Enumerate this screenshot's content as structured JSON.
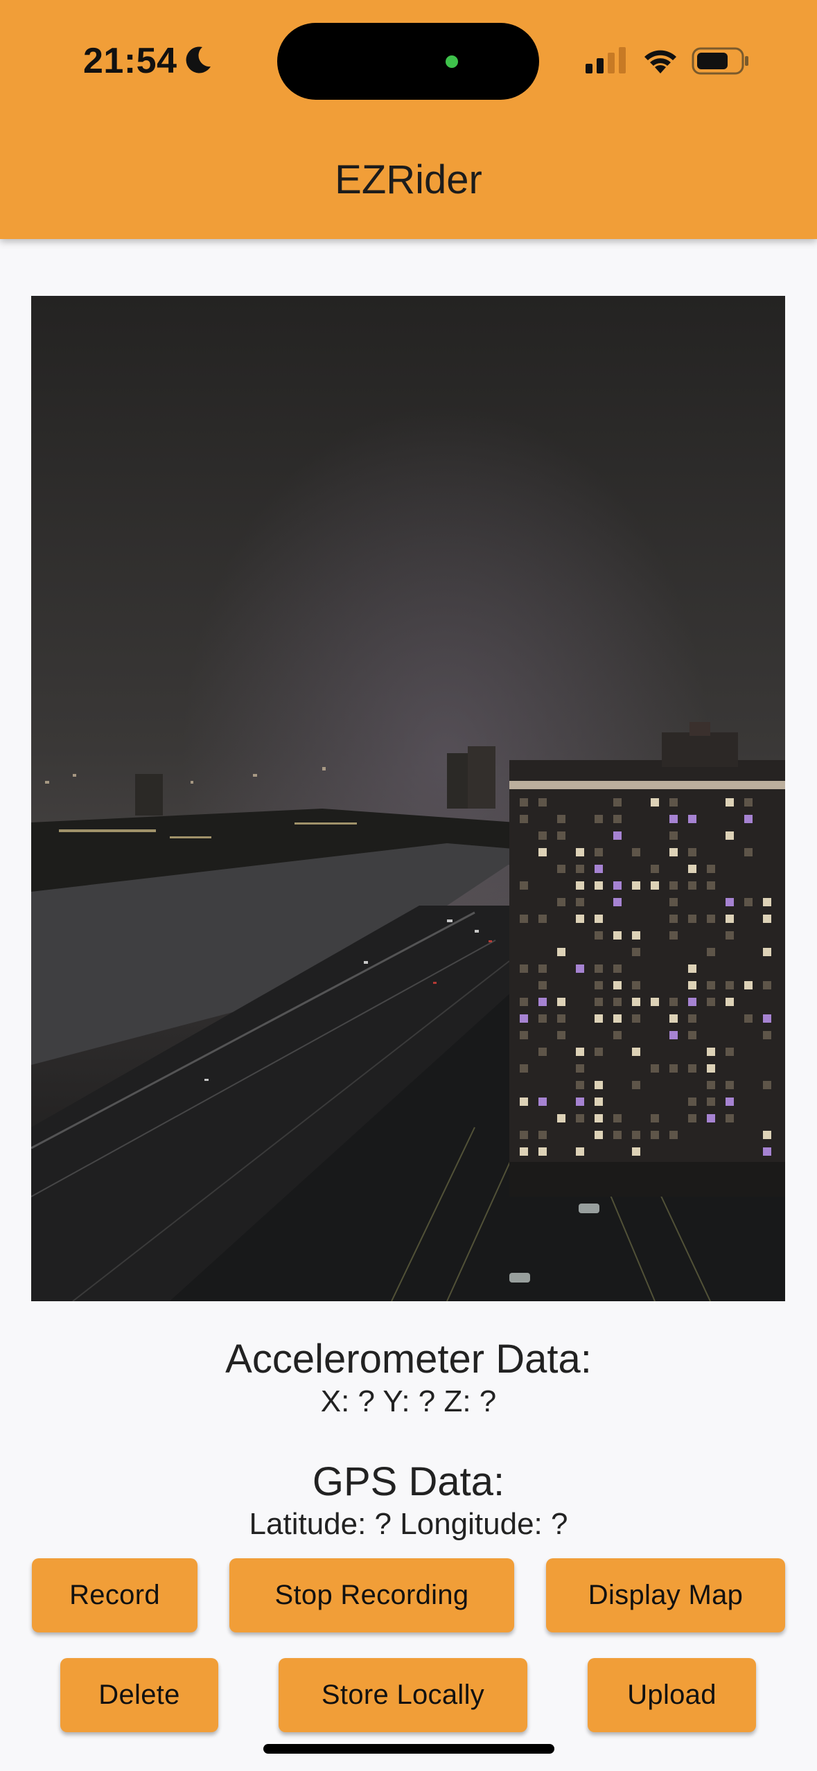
{
  "status_bar": {
    "time": "21:54",
    "icons": [
      "moon-icon",
      "signal-icon",
      "wifi-icon",
      "battery-icon"
    ]
  },
  "app_bar": {
    "title": "EZRider",
    "color": "#f19e38"
  },
  "accelerometer": {
    "title": "Accelerometer Data:",
    "values": "X: ? Y: ? Z: ?"
  },
  "gps": {
    "title": "GPS Data:",
    "values": "Latitude: ? Longitude: ?"
  },
  "buttons": {
    "record": "Record",
    "stop_recording": "Stop Recording",
    "display_map": "Display Map",
    "delete": "Delete",
    "store_locally": "Store Locally",
    "upload": "Upload"
  }
}
